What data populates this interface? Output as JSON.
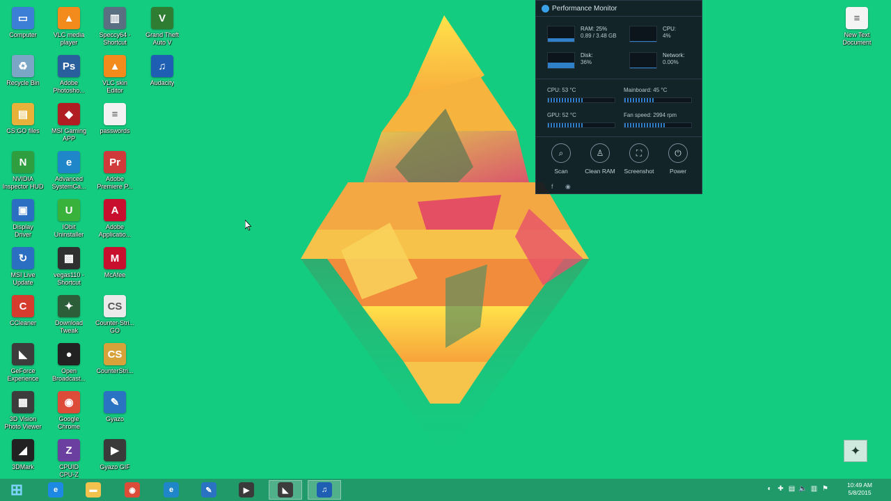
{
  "desktop_icons": [
    {
      "id": "computer",
      "label": "Computer",
      "glyph": "▭",
      "color": "#3b7fd6"
    },
    {
      "id": "recycle-bin",
      "label": "Recycle Bin",
      "glyph": "♻",
      "color": "#7ca6c6"
    },
    {
      "id": "csgo-folder",
      "label": "CS:GO files",
      "glyph": "▤",
      "color": "#e8b23a"
    },
    {
      "id": "geforce-now-hud",
      "label": "NVIDIA\nInspector HUD",
      "glyph": "N",
      "color": "#2f9e3e"
    },
    {
      "id": "display-driver",
      "label": "Display\nDriver",
      "glyph": "▣",
      "color": "#2b6fc2"
    },
    {
      "id": "msi-live-update",
      "label": "MSI Live\nUpdate",
      "glyph": "↻",
      "color": "#2b6fc2"
    },
    {
      "id": "ccleaner",
      "label": "CCleaner",
      "glyph": "C",
      "color": "#d63c2e"
    },
    {
      "id": "geforce-experience",
      "label": "GeForce\nExperience",
      "glyph": "◣",
      "color": "#3c3c3c"
    },
    {
      "id": "3d-vision-viewer",
      "label": "3D Vision\nPhoto Viewer",
      "glyph": "▦",
      "color": "#3c3c3c"
    },
    {
      "id": "3dmark",
      "label": "3DMark",
      "glyph": "◢",
      "color": "#222222"
    },
    {
      "id": "vlc-player",
      "label": "VLC media\nplayer",
      "glyph": "▲",
      "color": "#f28a1c"
    },
    {
      "id": "photoshop",
      "label": "Adobe\nPhotosho...",
      "glyph": "Ps",
      "color": "#2a5f9e"
    },
    {
      "id": "msi-gaming-app",
      "label": "MSI Gaming\nAPP",
      "glyph": "◆",
      "color": "#b01e23"
    },
    {
      "id": "advanced-systemcare",
      "label": "Advanced\nSystemCa...",
      "glyph": "e",
      "color": "#1f86c9"
    },
    {
      "id": "iobit-uninstaller",
      "label": "IObit\nUninstaller",
      "glyph": "U",
      "color": "#38b23a"
    },
    {
      "id": "vegas-pro",
      "label": "vegas110 -\nShortcut",
      "glyph": "▩",
      "color": "#303030"
    },
    {
      "id": "download-tweak",
      "label": "Download\nTweak",
      "glyph": "✦",
      "color": "#2d5e3a"
    },
    {
      "id": "open-broadcaster",
      "label": "Open\nBroadcast...",
      "glyph": "●",
      "color": "#222222"
    },
    {
      "id": "google-chrome",
      "label": "Google\nChrome",
      "glyph": "◉",
      "color": "#dd4b39"
    },
    {
      "id": "cpuid-cpu-z",
      "label": "CPUID\nCPU-Z",
      "glyph": "Z",
      "color": "#6a3fa0"
    },
    {
      "id": "speccy",
      "label": "Speccy64 -\nShortcut",
      "glyph": "▥",
      "color": "#5a6f82"
    },
    {
      "id": "vlc-skins",
      "label": "VLC skin\nEditor",
      "glyph": "▲",
      "color": "#f28a1c"
    },
    {
      "id": "passwords",
      "label": "passwords",
      "glyph": "≡",
      "color": "#f2f2f2"
    },
    {
      "id": "adobe-premiere",
      "label": "Adobe\nPremiere P...",
      "glyph": "Pr",
      "color": "#d03a3a"
    },
    {
      "id": "adobe-acrobat",
      "label": "Adobe\nApplicatio...",
      "glyph": "A",
      "color": "#c8102e"
    },
    {
      "id": "mcafee",
      "label": "McAfee",
      "glyph": "M",
      "color": "#c8102e"
    },
    {
      "id": "counter-strike",
      "label": "Counter-Stri...\nGO",
      "glyph": "CS",
      "color": "#eaeaea"
    },
    {
      "id": "counter-strike-2",
      "label": "CounterStri...",
      "glyph": "CS",
      "color": "#d8a23a"
    },
    {
      "id": "gyazo",
      "label": "Gyazo",
      "glyph": "✎",
      "color": "#2a73c2"
    },
    {
      "id": "gyazo-gif",
      "label": "Gyazo GIF",
      "glyph": "▶",
      "color": "#3a3a3a"
    },
    {
      "id": "gta-v",
      "label": "Grand Theft\nAuto V",
      "glyph": "V",
      "color": "#2e7d32"
    },
    {
      "id": "audacity",
      "label": "Audacity",
      "glyph": "♫",
      "color": "#1e5fb4"
    },
    {
      "id": "new-text-document",
      "label": "New Text\nDocument",
      "glyph": "≡",
      "color": "#f4f4f4"
    }
  ],
  "perf_monitor": {
    "title": "Performance Monitor",
    "metrics": [
      {
        "id": "ram",
        "label": "RAM: 25%",
        "sub": "0.89 / 3.48 GB",
        "level": 0.25
      },
      {
        "id": "cpu",
        "label": "CPU:",
        "sub": "4%",
        "level": 0.04
      },
      {
        "id": "disk",
        "label": "Disk:",
        "sub": "36%",
        "level": 0.36
      },
      {
        "id": "network",
        "label": "Network:",
        "sub": "0.00%",
        "level": 0.0
      }
    ],
    "sensors": [
      {
        "id": "cpu-temp",
        "label": "CPU: 53 °C",
        "level": 0.53
      },
      {
        "id": "mainboard-temp",
        "label": "Mainboard: 45 °C",
        "level": 0.45
      },
      {
        "id": "gpu-temp",
        "label": "GPU: 52 °C",
        "level": 0.52
      },
      {
        "id": "fan-speed",
        "label": "Fan speed: 2994 rpm",
        "level": 0.6
      }
    ],
    "buttons": [
      {
        "id": "scan",
        "label": "Scan",
        "glyph": "⌕"
      },
      {
        "id": "clean-ram",
        "label": "Clean RAM",
        "glyph": "♙"
      },
      {
        "id": "screenshot",
        "label": "Screenshot",
        "glyph": "⛶"
      },
      {
        "id": "power",
        "label": "Power",
        "glyph": "⏻"
      }
    ],
    "social": [
      "f",
      "◉"
    ]
  },
  "taskbar": {
    "items": [
      {
        "id": "start",
        "glyph": "⊞",
        "color": "#1f9a68",
        "active": false
      },
      {
        "id": "internet-explorer",
        "glyph": "e",
        "color": "#1e88e5",
        "active": false
      },
      {
        "id": "file-explorer",
        "glyph": "▬",
        "color": "#f2c14e",
        "active": false
      },
      {
        "id": "google-chrome",
        "glyph": "◉",
        "color": "#dd4b39",
        "active": false
      },
      {
        "id": "advanced-systemcare",
        "glyph": "e",
        "color": "#1f86c9",
        "active": false
      },
      {
        "id": "gyazo",
        "glyph": "✎",
        "color": "#2a73c2",
        "active": false
      },
      {
        "id": "gyazo-gif",
        "glyph": "▶",
        "color": "#3a3a3a",
        "active": false
      },
      {
        "id": "geforce-experience",
        "glyph": "◣",
        "color": "#3c3c3c",
        "active": true
      },
      {
        "id": "audacity",
        "glyph": "♫",
        "color": "#1e5fb4",
        "active": true
      }
    ],
    "tray": [
      "◐",
      "✚",
      "▤",
      "🔈",
      "▥",
      "⚑"
    ],
    "time": "10:49 AM",
    "date": "5/8/2015"
  },
  "corner_widget_glyph": "✦"
}
